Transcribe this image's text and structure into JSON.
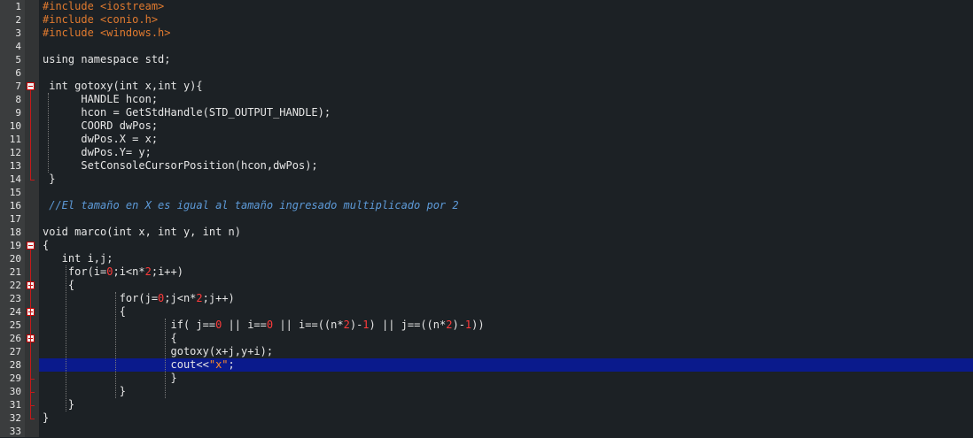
{
  "editor": {
    "line_numbers": [
      "1",
      "2",
      "3",
      "4",
      "5",
      "6",
      "7",
      "8",
      "9",
      "10",
      "11",
      "12",
      "13",
      "14",
      "15",
      "16",
      "17",
      "18",
      "19",
      "20",
      "21",
      "22",
      "23",
      "24",
      "25",
      "26",
      "27",
      "28",
      "29",
      "30",
      "31",
      "32",
      "33"
    ],
    "lines": [
      [
        {
          "t": "#include <iostream>",
          "c": "pp"
        }
      ],
      [
        {
          "t": "#include <conio.h>",
          "c": "pp"
        }
      ],
      [
        {
          "t": "#include <windows.h>",
          "c": "pp"
        }
      ],
      [],
      [
        {
          "t": "using namespace std;",
          "c": ""
        }
      ],
      [],
      [
        {
          "t": " int gotoxy(int x,int y){",
          "c": ""
        }
      ],
      [
        {
          "t": "      HANDLE hcon;",
          "c": ""
        }
      ],
      [
        {
          "t": "      hcon = GetStdHandle(STD_OUTPUT_HANDLE);",
          "c": ""
        }
      ],
      [
        {
          "t": "      COORD dwPos;",
          "c": ""
        }
      ],
      [
        {
          "t": "      dwPos.X = x;",
          "c": ""
        }
      ],
      [
        {
          "t": "      dwPos.Y= y;",
          "c": ""
        }
      ],
      [
        {
          "t": "      SetConsoleCursorPosition(hcon,dwPos);",
          "c": ""
        }
      ],
      [
        {
          "t": " }",
          "c": ""
        }
      ],
      [],
      [
        {
          "t": " //El tamaño en X es igual al tamaño ingresado multiplicado por 2",
          "c": "cm"
        }
      ],
      [],
      [
        {
          "t": "void marco(int x, int y, int n)",
          "c": ""
        }
      ],
      [
        {
          "t": "{",
          "c": ""
        }
      ],
      [
        {
          "t": "   int i,j;",
          "c": ""
        }
      ],
      [
        {
          "t": "    for(i=",
          "c": ""
        },
        {
          "t": "0",
          "c": "num"
        },
        {
          "t": ";i<n*",
          "c": ""
        },
        {
          "t": "2",
          "c": "num"
        },
        {
          "t": ";i++)",
          "c": ""
        }
      ],
      [
        {
          "t": "    {",
          "c": ""
        }
      ],
      [
        {
          "t": "            for(j=",
          "c": ""
        },
        {
          "t": "0",
          "c": "num"
        },
        {
          "t": ";j<n*",
          "c": ""
        },
        {
          "t": "2",
          "c": "num"
        },
        {
          "t": ";j++)",
          "c": ""
        }
      ],
      [
        {
          "t": "            {",
          "c": ""
        }
      ],
      [
        {
          "t": "                    if( j==",
          "c": ""
        },
        {
          "t": "0",
          "c": "num"
        },
        {
          "t": " || i==",
          "c": ""
        },
        {
          "t": "0",
          "c": "num"
        },
        {
          "t": " || i==((n*",
          "c": ""
        },
        {
          "t": "2",
          "c": "num"
        },
        {
          "t": ")-",
          "c": ""
        },
        {
          "t": "1",
          "c": "num"
        },
        {
          "t": ") || j==((n*",
          "c": ""
        },
        {
          "t": "2",
          "c": "num"
        },
        {
          "t": ")-",
          "c": ""
        },
        {
          "t": "1",
          "c": "num"
        },
        {
          "t": "))",
          "c": ""
        }
      ],
      [
        {
          "t": "                    {",
          "c": ""
        }
      ],
      [
        {
          "t": "                    gotoxy(x+j,y+i);",
          "c": ""
        }
      ],
      [
        {
          "t": "                    cout<<",
          "c": ""
        },
        {
          "t": "\"x\"",
          "c": "str"
        },
        {
          "t": ";",
          "c": ""
        }
      ],
      [
        {
          "t": "                    }",
          "c": ""
        }
      ],
      [
        {
          "t": "            }",
          "c": ""
        }
      ],
      [
        {
          "t": "    }",
          "c": ""
        }
      ],
      [
        {
          "t": "}",
          "c": ""
        }
      ],
      []
    ],
    "current_line": 28,
    "fold_markers": [
      7,
      19,
      22,
      24,
      26
    ]
  }
}
